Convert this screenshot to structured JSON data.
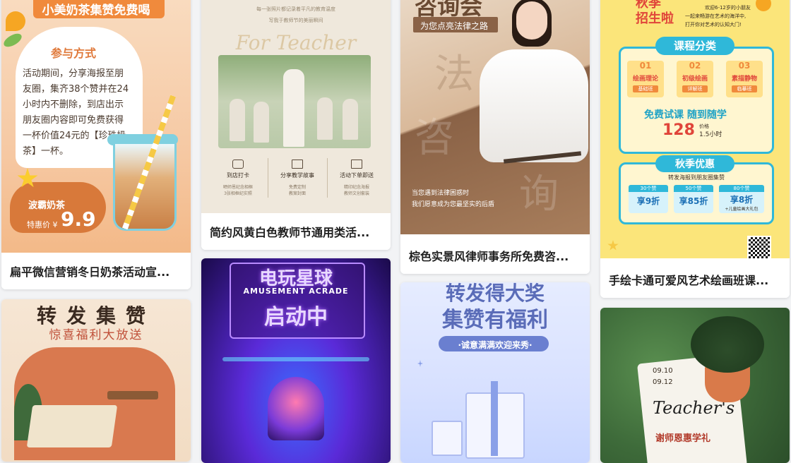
{
  "cards": [
    {
      "title": "扁平微信营销冬日奶茶活动宣...",
      "top_banner": "小美奶茶集赞免费喝",
      "rules_heading": "参与方式",
      "rules_body": [
        "活动期间，分享海报至朋",
        "友圈，集齐38个赞并在24",
        "小时内不删除，到店出示",
        "朋友圈内容即可免费获得",
        "一杯价值24元的【珍珠奶",
        "茶】一杯。"
      ],
      "product_name": "波霸奶茶",
      "price_label": "特惠价 ¥",
      "price": "9.9"
    },
    {
      "title": "简约风黄白色教师节通用类活...",
      "top_line1": "每一张照片都记录着平凡的教育温度",
      "top_line2": "写我于教师节的美丽瞬间",
      "script_text": "For Teacher",
      "features": [
        {
          "label": "到店打卡",
          "desc1": "晒师恩纪念相框",
          "desc2": "3张相框纪实照"
        },
        {
          "label": "分享教学故事",
          "desc1": "免费定制",
          "desc2": "教案封面"
        },
        {
          "label": "活动下单即送",
          "desc1": "精印纪念海报",
          "desc2": "教师文创套装"
        }
      ]
    },
    {
      "title": "棕色实景风律师事务所免费咨...",
      "headline": "咨询会",
      "subline": "为您点亮法律之路",
      "big_char1": "法",
      "big_char2": "询",
      "big_char3": "咨",
      "bottom_line1": "当您遇到法律困惑时",
      "bottom_line2": "我们愿意成为您最坚实的后盾"
    },
    {
      "title": "手绘卡通可爱风艺术绘画班课...",
      "season_banner": "秋季",
      "season_sub": "招生啦",
      "intro1": "欢迎6-12岁的小朋友",
      "intro2": "一起来畅游在艺术的海洋中,",
      "intro3": "打开你对艺术的认知大门!",
      "course_heading": "课程分类",
      "courses": [
        {
          "num": "01",
          "name": "绘画理论",
          "tag": "基础班"
        },
        {
          "num": "02",
          "name": "初级绘画",
          "tag": "详解班"
        },
        {
          "num": "03",
          "name": "素描静物",
          "tag": "临摹班"
        }
      ],
      "trial_text": "免费试课  随到随学",
      "trial_price": "128",
      "trial_price_unit": "价格",
      "trial_duration": "1.5小时",
      "offer_heading": "秋季优惠",
      "offer_sub": "转发海报到朋友圈集赞",
      "offers": [
        {
          "likes": "30个赞",
          "discount": "享9折",
          "extra": ""
        },
        {
          "likes": "50个赞",
          "discount": "享85折",
          "extra": ""
        },
        {
          "likes": "80个赞",
          "discount": "享8折",
          "extra": "+儿童绘画大礼包"
        }
      ]
    },
    {
      "title": "",
      "headline": "转发集赞",
      "subline": "惊喜福利大放送"
    },
    {
      "title": "",
      "line1": "电玩星球",
      "line2": "AMUSEMENT ACRADE",
      "line3": "启动中"
    },
    {
      "title": "",
      "line1": "转发得大奖",
      "line2": "集赞有福利",
      "line3": "·诚意满满欢迎来秀·"
    },
    {
      "title": "",
      "date1": "09.10",
      "date2": "09.12",
      "script": "Teacher's",
      "cn_text": "谢师恩惠学礼"
    }
  ],
  "colors": {
    "page_bg": "#f2f3f5",
    "milk_orange": "#f08a3c",
    "teacher_beige": "#efe8dc",
    "lawyer_brown": "#8a6246",
    "art_yellow": "#fbe57a",
    "art_blue": "#2fb8d9",
    "game_purple": "#5a2ad8",
    "gift_blue": "#c8d6ff",
    "plant_green": "#3e6b3a"
  }
}
